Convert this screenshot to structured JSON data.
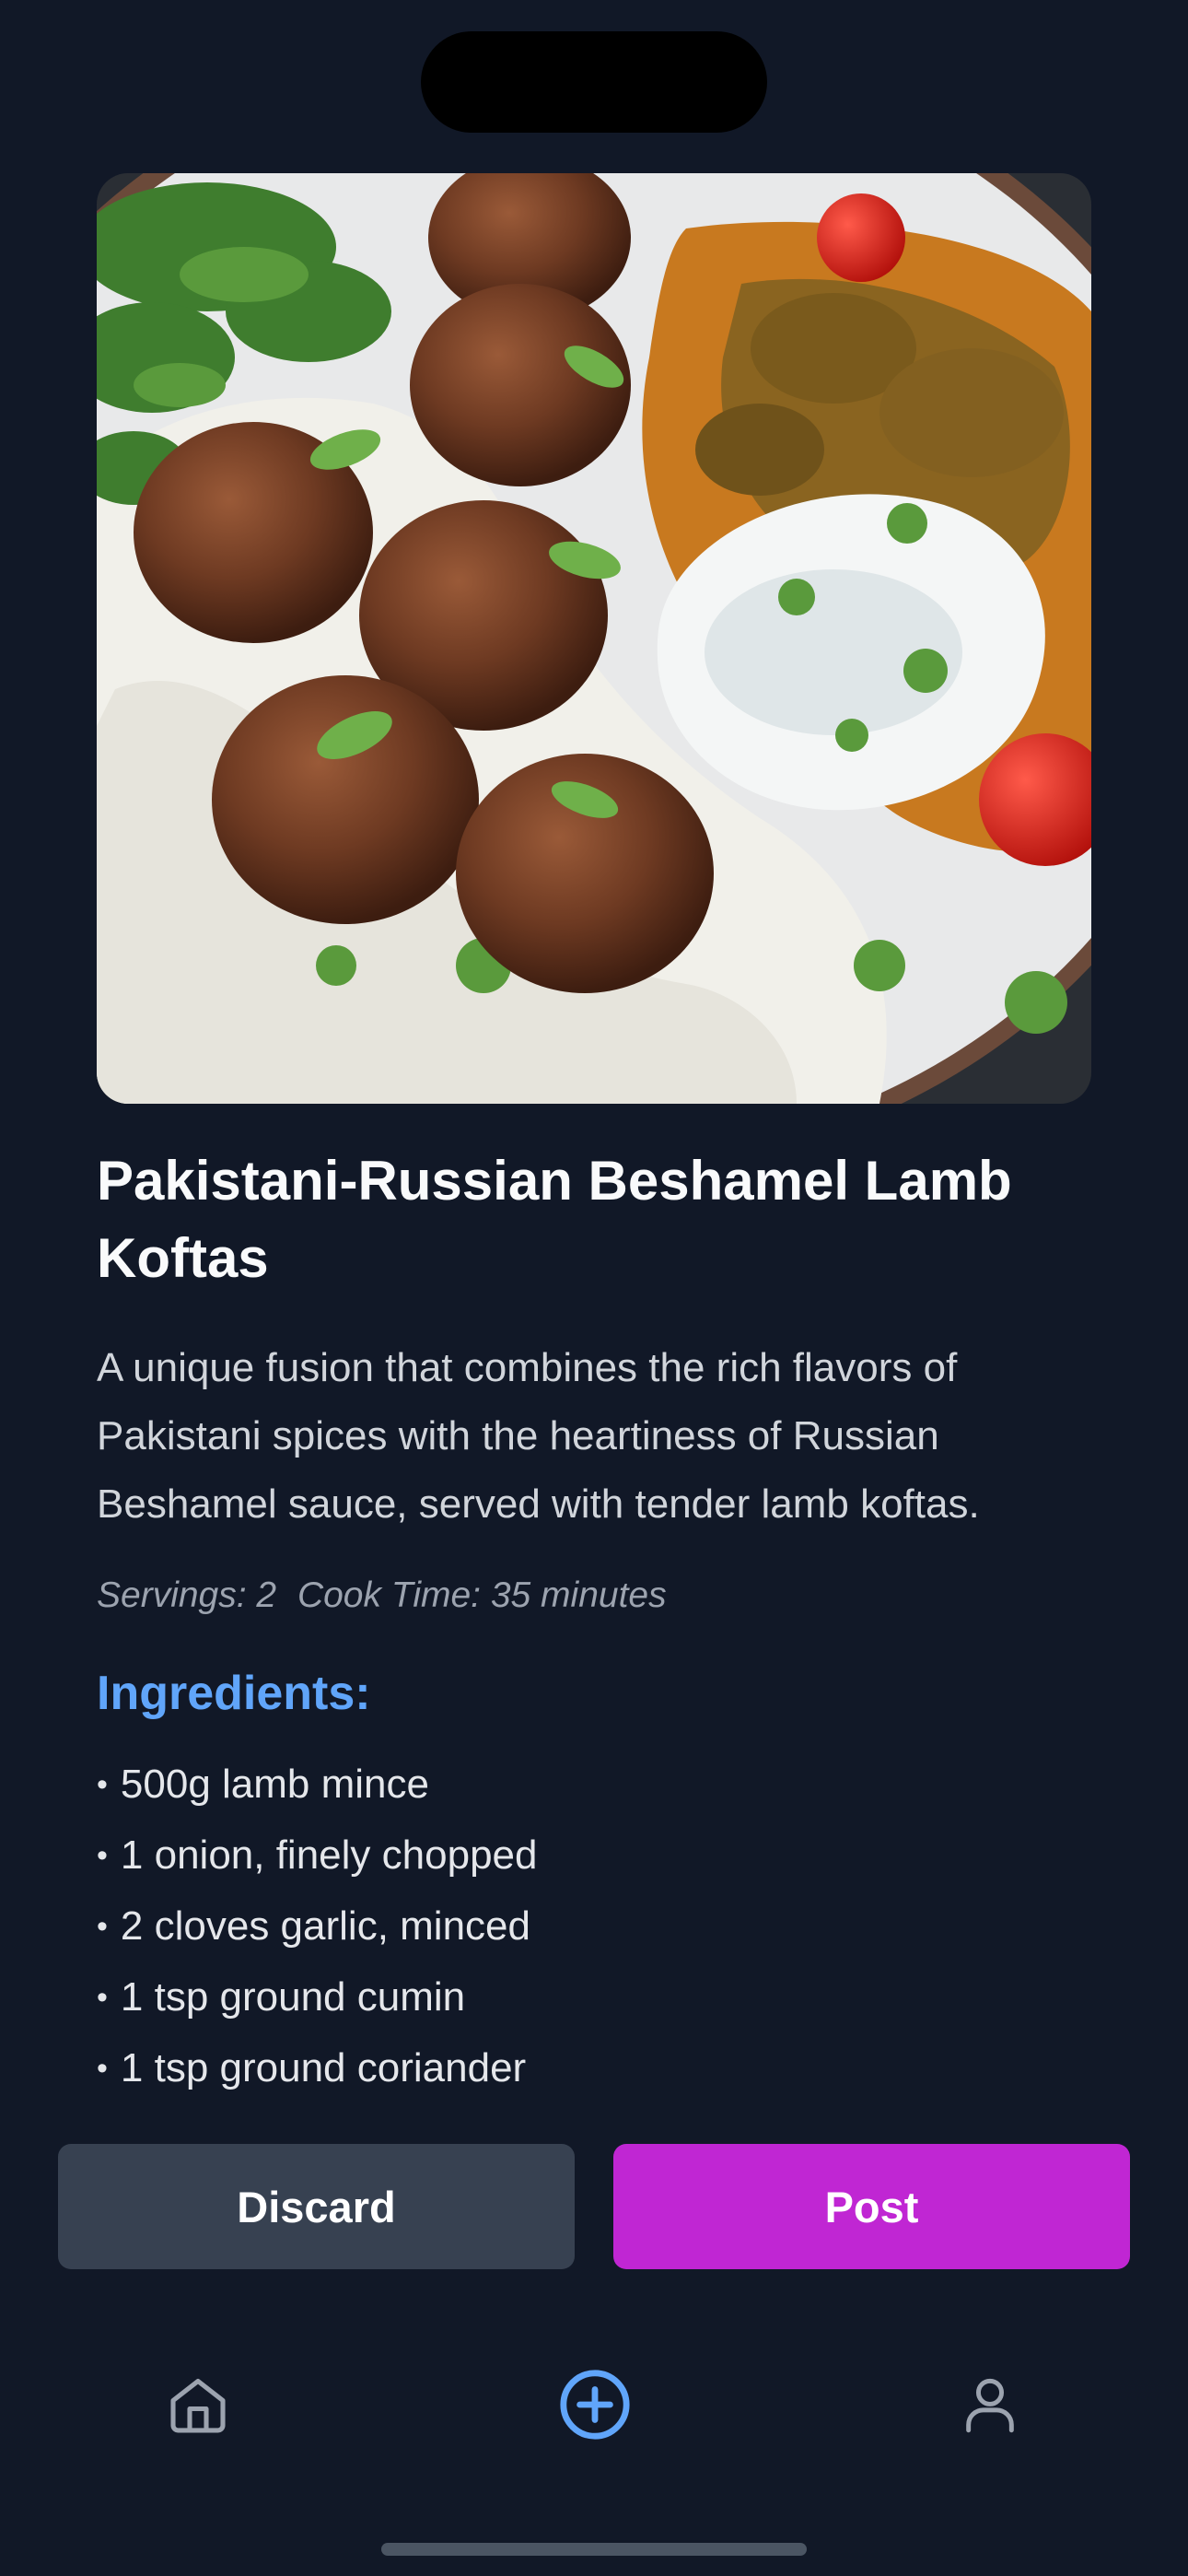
{
  "recipe": {
    "title": "Pakistani-Russian Beshamel Lamb Koftas",
    "description": "A unique fusion that combines the rich flavors of Pakistani spices with the heartiness of Russian Beshamel sauce, served with tender lamb koftas.",
    "servings": "Servings: 2",
    "cook_time": "Cook Time: 35 minutes",
    "ingredients_heading": "Ingredients:",
    "ingredients": [
      "500g lamb mince",
      "1 onion, finely chopped",
      "2 cloves garlic, minced",
      "1 tsp ground cumin",
      "1 tsp ground coriander"
    ]
  },
  "actions": {
    "discard_label": "Discard",
    "post_label": "Post"
  },
  "nav": {
    "items": [
      {
        "icon": "home-icon",
        "active": false
      },
      {
        "icon": "plus-circle-icon",
        "active": true
      },
      {
        "icon": "user-icon",
        "active": false
      }
    ]
  },
  "colors": {
    "background": "#111827",
    "accent_heading": "#60a5fa",
    "post_button": "#c026d3",
    "discard_button": "#374151",
    "nav_active": "#60a5fa",
    "nav_inactive": "#9ca3af"
  }
}
